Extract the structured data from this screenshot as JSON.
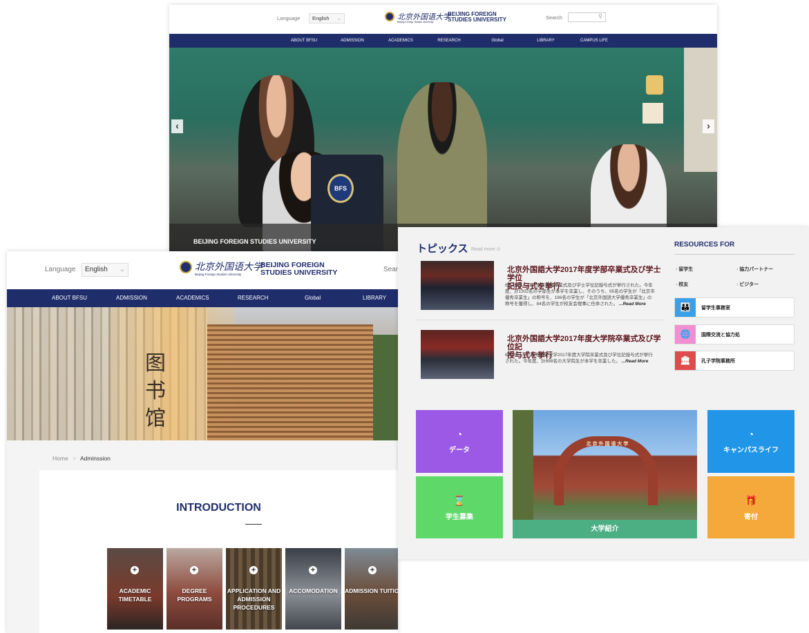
{
  "top_page": {
    "language_label": "Language",
    "language_value": "English",
    "logo_cn": "北京外国语大学",
    "logo_sub": "Beijing Foreign Studies University",
    "logo_en_line1": "BEIJING FOREIGN",
    "logo_en_line2": "STUDIES UNIVERSITY",
    "search_label": "Search",
    "nav": [
      "ABOUT BFSU",
      "ADMISSION",
      "ACADEMICS",
      "RESEARCH",
      "Global",
      "LIBRARY",
      "CAMPUS LIFE"
    ],
    "hero_caption": "BEIJING FOREIGN STUDIES UNIVERSITY",
    "badge_text": "BFS",
    "arrow_left": "‹",
    "arrow_right": "›"
  },
  "admission_page": {
    "language_label": "Language",
    "language_value": "English",
    "logo_cn": "北京外国语大学",
    "logo_sub": "Beijing Foreign Studies University",
    "logo_en_line1": "BEIJING FOREIGN",
    "logo_en_line2": "STUDIES UNIVERSITY",
    "search_label": "Searc",
    "nav": [
      "ABOUT BFSU",
      "ADMISSION",
      "ACADEMICS",
      "RESEARCH",
      "Global",
      "LIBRARY"
    ],
    "breadcrumb_home": "Home",
    "breadcrumb_sep": ">",
    "breadcrumb_current": "Adminssion",
    "intro_title": "INTRODUCTION",
    "programs": [
      {
        "line1": "ACADEMIC",
        "line2": "TIMETABLE",
        "line3": ""
      },
      {
        "line1": "DEGREE PROGRAMS",
        "line2": "",
        "line3": ""
      },
      {
        "line1": "APPLICATION AND",
        "line2": "ADMISSION",
        "line3": "PROCEDURES"
      },
      {
        "line1": "ACCOMODATION",
        "line2": "",
        "line3": ""
      },
      {
        "line1": "ADMISSION TUITION",
        "line2": "",
        "line3": ""
      }
    ],
    "library_chars": [
      "图",
      "书",
      "馆"
    ]
  },
  "japanese_page": {
    "topics_title": "トピックス",
    "read_more": "Read more",
    "news": [
      {
        "title_line1": "北京外国語大学2017年度学部卒業式及び学士学位",
        "title_line2": "記授与式を挙行",
        "body": [
          "6月28日、2017年度学部卒業式及び学士学位記授与式が挙行された。今年",
          "度、計1302名の学部生が本学を卒業し、そのうち、95名の学生が「北京市",
          "優秀卒業生」の称号を、196名の学生が「北京外国語大学優秀卒業生」の",
          "称号を獲得し、84名の学生が校友会理事に任命された。"
        ],
        "more": "...Read More"
      },
      {
        "title_line1": "北京外国語大学2017年度大学院卒業式及び学位記",
        "title_line2": "授与式を挙行",
        "body": [
          "6月29日、北京外国語大学2017年度大学院卒業式及び学位記授与式が挙行",
          "された。今年度、計898名の大学院生が本学を卒業した。"
        ],
        "more": "...Read More"
      }
    ],
    "resources_title": "RESOURCES FOR",
    "resource_links": [
      "留学生",
      "協力パートナー",
      "校友",
      "ビジター"
    ],
    "resource_buttons": [
      {
        "label": "留学生事務室",
        "color": "#3aa0e8",
        "icon": "👪"
      },
      {
        "label": "国際交流と協力処",
        "color": "#f28ed2",
        "icon": "🌐"
      },
      {
        "label": "孔子学院事務所",
        "color": "#e04b4b",
        "icon": "🏛"
      }
    ],
    "tiles": {
      "data": {
        "label": "データ",
        "icon": "◔",
        "color": "#9b59e6"
      },
      "recruit": {
        "label": "学生募集",
        "icon": "⌛",
        "color": "#5fd86a"
      },
      "about": {
        "label": "大学紹介",
        "color": "#4caf84"
      },
      "campus": {
        "label": "キャンパスライフ",
        "icon": "◔",
        "color": "#2196e8"
      },
      "donate": {
        "label": "寄付",
        "icon": "🎁",
        "color": "#f4a93a"
      }
    },
    "gate_text": "北 京 外 国 语 大 学"
  },
  "colors": {
    "navy": "#1f2d6b",
    "maroon": "#5a1218"
  }
}
